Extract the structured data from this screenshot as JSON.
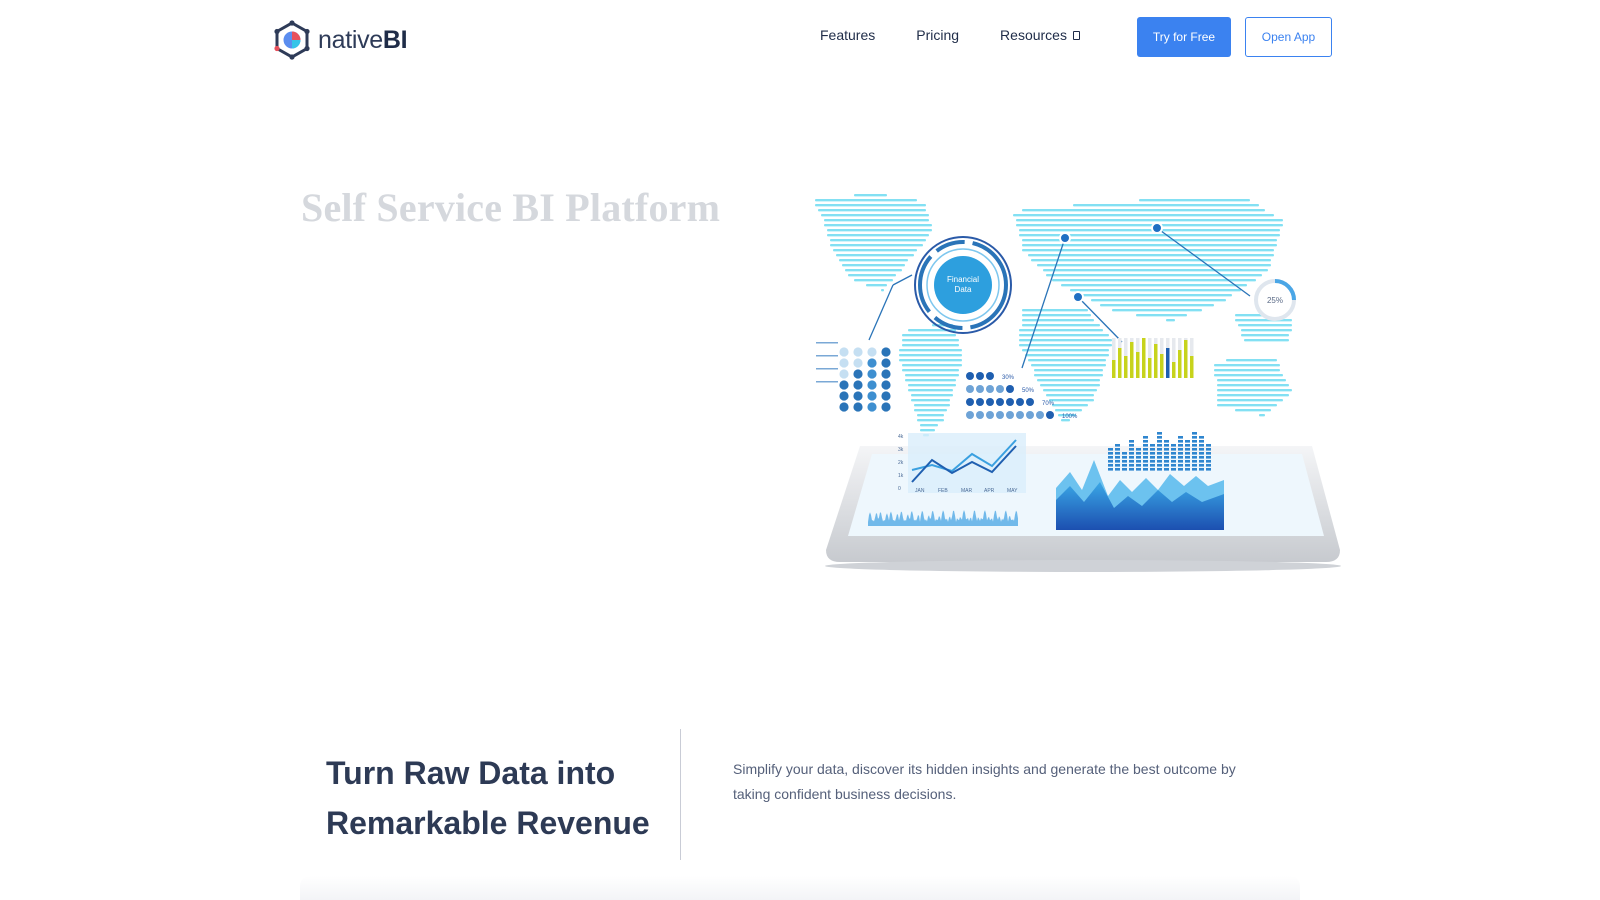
{
  "brand": {
    "name_light": "native",
    "name_bold": "BI",
    "colors": {
      "accent": "#3b82f0",
      "text_dark": "#2d3a55",
      "hero_title": "#d5d8dd",
      "map_cyan": "#4fd3ee"
    }
  },
  "nav": {
    "items": [
      {
        "label": "Features"
      },
      {
        "label": "Pricing"
      },
      {
        "label": "Resources",
        "icon": "chevron-down-icon"
      }
    ],
    "try_free_label": "Try for Free",
    "open_app_label": "Open App"
  },
  "hero": {
    "title": "Self Service BI Platform",
    "illustration": {
      "hub_label_line1": "Financial",
      "hub_label_line2": "Data",
      "donut_label": "25%",
      "percent_rows": [
        "30%",
        "50%",
        "70%",
        "100%"
      ],
      "chart_months": [
        "JAN",
        "FEB",
        "MAR",
        "APR",
        "MAY"
      ],
      "y_ticks": [
        "4k",
        "3k",
        "2k",
        "1k",
        "0"
      ]
    }
  },
  "section": {
    "heading": "Turn Raw Data into Remarkable Revenue",
    "body": "Simplify your data, discover its hidden insights and generate the best outcome by taking confident business decisions."
  }
}
